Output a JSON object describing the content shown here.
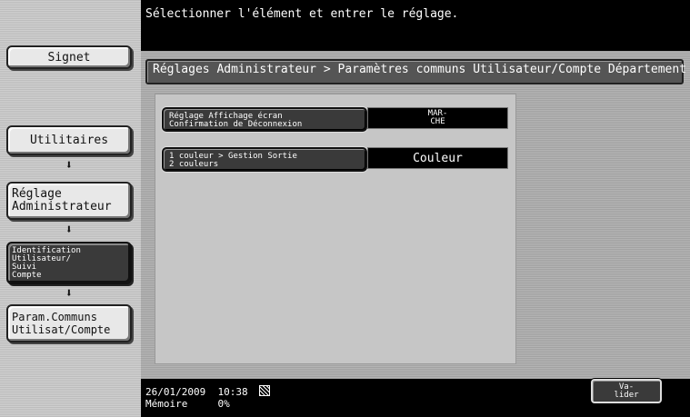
{
  "instruction": "Sélectionner l'élément et entrer le réglage.",
  "sidebar": {
    "signet_label": "Signet",
    "steps": [
      {
        "label": "Utilitaires"
      },
      {
        "label_line1": "Réglage",
        "label_line2": "Administrateur"
      },
      {
        "label_line1": "Identification",
        "label_line2": "Utilisateur/",
        "label_line3": "Suivi",
        "label_line4": "Compte"
      },
      {
        "label_line1": "Param.Communs",
        "label_line2": "Utilisat/Compte"
      }
    ],
    "arrow": "⬇"
  },
  "header": {
    "title": "Réglages Administrateur > Paramètres communs Utilisateur/Compte Département"
  },
  "settings": [
    {
      "label_line1": "Réglage Affichage écran",
      "label_line2": "Confirmation de Déconnexion",
      "value_line1": "MAR-",
      "value_line2": "CHE"
    },
    {
      "label_line1": "1 couleur > Gestion Sortie",
      "label_line2": "2 couleurs",
      "value": "Couleur"
    }
  ],
  "status": {
    "date": "26/01/2009",
    "time": "10:38",
    "memory_label": "Mémoire",
    "memory_value": "0%"
  },
  "valider": {
    "line1": "Va-",
    "line2": "lider"
  }
}
